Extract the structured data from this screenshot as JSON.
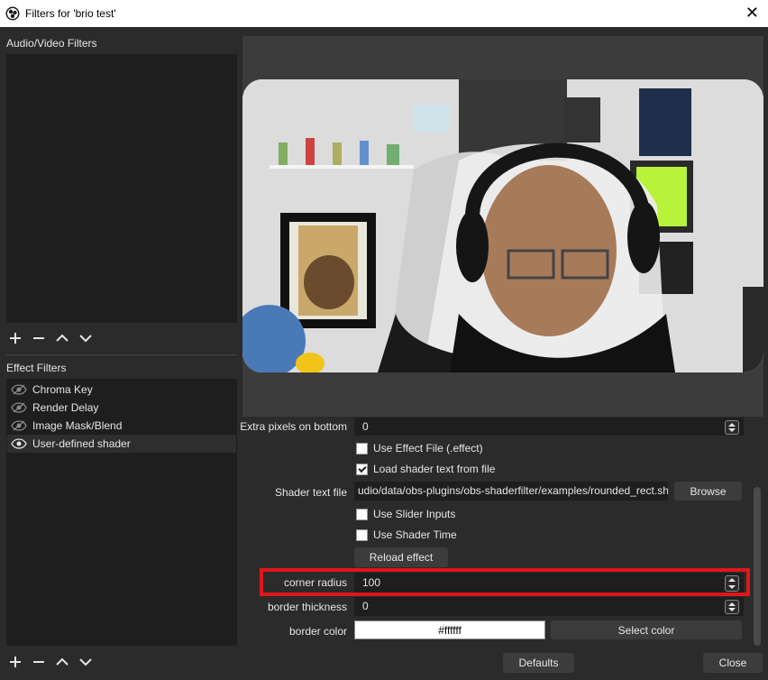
{
  "window": {
    "title": "Filters for 'brio test'",
    "close_glyph": "✕"
  },
  "audio_video_filters": {
    "label": "Audio/Video Filters",
    "items": []
  },
  "effect_filters": {
    "label": "Effect Filters",
    "items": [
      {
        "label": "Chroma Key",
        "visible": false,
        "selected": false
      },
      {
        "label": "Render Delay",
        "visible": false,
        "selected": false
      },
      {
        "label": "Image Mask/Blend",
        "visible": false,
        "selected": false
      },
      {
        "label": "User-defined shader",
        "visible": true,
        "selected": true
      }
    ]
  },
  "toolbar": {
    "add_glyph": "+",
    "remove_glyph": "−",
    "up_glyph": "⌃",
    "down_glyph": "⌄"
  },
  "properties": {
    "extra_pixels_bottom": {
      "label": "Extra pixels on bottom",
      "value": "0"
    },
    "use_effect_file": {
      "label": "Use Effect File (.effect)",
      "checked": false
    },
    "load_shader_text": {
      "label": "Load shader text from file",
      "checked": true
    },
    "shader_text_file": {
      "label": "Shader text file",
      "value": "udio/data/obs-plugins/obs-shaderfilter/examples/rounded_rect.shader",
      "browse_label": "Browse"
    },
    "use_slider_inputs": {
      "label": "Use Slider Inputs",
      "checked": false
    },
    "use_shader_time": {
      "label": "Use Shader Time",
      "checked": false
    },
    "reload_effect": {
      "label": "Reload effect"
    },
    "corner_radius": {
      "label": "corner radius",
      "value": "100"
    },
    "border_thickness": {
      "label": "border thickness",
      "value": "0"
    },
    "border_color": {
      "label": "border color",
      "value": "#ffffff",
      "select_label": "Select color"
    }
  },
  "footer": {
    "defaults_label": "Defaults",
    "close_label": "Close"
  },
  "colors": {
    "background": "#2b2b2b",
    "panel": "#1e1e1e",
    "highlight": "#e0161a"
  }
}
